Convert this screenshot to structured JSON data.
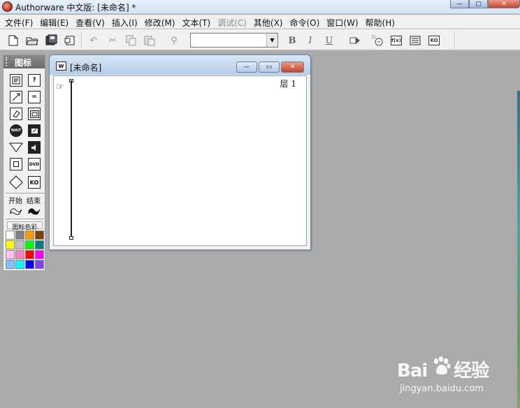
{
  "app": {
    "title": "Authorware 中文版: [未命名] *",
    "window_buttons": {
      "minimize": "—",
      "maximize": "□",
      "close": "✕"
    }
  },
  "menubar": {
    "items": [
      {
        "label": "文件(F)",
        "enabled": true
      },
      {
        "label": "编辑(E)",
        "enabled": true
      },
      {
        "label": "查看(V)",
        "enabled": true
      },
      {
        "label": "插入(I)",
        "enabled": true
      },
      {
        "label": "修改(M)",
        "enabled": true
      },
      {
        "label": "文本(T)",
        "enabled": true
      },
      {
        "label": "调试(C)",
        "enabled": false
      },
      {
        "label": "其他(X)",
        "enabled": true
      },
      {
        "label": "命令(O)",
        "enabled": true
      },
      {
        "label": "窗口(W)",
        "enabled": true
      },
      {
        "label": "帮助(H)",
        "enabled": true
      }
    ]
  },
  "toolbar": {
    "new_icon": "new-file-icon",
    "open_icon": "open-folder-icon",
    "save_all_icon": "save-all-icon",
    "import_icon": "import-icon",
    "undo_icon": "undo-icon",
    "cut_icon": "cut-icon",
    "copy_icon": "copy-icon",
    "paste_icon": "paste-icon",
    "find_icon": "find-icon",
    "font_select_value": "",
    "bold_label": "B",
    "italic_label": "I",
    "underline_label": "U",
    "run_icon": "run-icon",
    "control_panel_icon": "control-panel-icon",
    "functions_label": "f(x)",
    "variables_icon": "variables-icon",
    "knowledge_objects_label": "KO"
  },
  "palette": {
    "title": "图标",
    "icons": [
      {
        "name": "display-icon"
      },
      {
        "name": "motion-icon"
      },
      {
        "name": "erase-icon"
      },
      {
        "name": "wait-icon"
      },
      {
        "name": "navigate-icon"
      },
      {
        "name": "framework-icon"
      },
      {
        "name": "decision-icon"
      },
      {
        "name": "interaction-icon"
      },
      {
        "name": "calculation-icon"
      },
      {
        "name": "map-icon"
      },
      {
        "name": "digital-movie-icon"
      },
      {
        "name": "sound-icon"
      },
      {
        "name": "video-icon"
      },
      {
        "name": "knowledge-object-icon"
      }
    ],
    "icon_text": {
      "wait": "WAIT",
      "dvd": "DVD",
      "ko": "KO",
      "calc": "="
    },
    "start_label": "开始",
    "end_label": "结束",
    "color_label": "图标色彩",
    "colors": [
      "#ffffff",
      "#808080",
      "#ff9900",
      "#804000",
      "#ffff00",
      "#c0c0c0",
      "#00ff00",
      "#008080",
      "#ffc0ff",
      "#ff80c0",
      "#ff0000",
      "#ff00ff",
      "#80c0ff",
      "#00ffff",
      "#0000ff",
      "#8040ff"
    ]
  },
  "design_window": {
    "title": "[未命名]",
    "icon_label": "W",
    "layer_label": "层 1",
    "buttons": {
      "minimize": "—",
      "restore": "▭",
      "close": "✕"
    }
  },
  "watermark": {
    "logo_text_1": "Bai",
    "logo_text_2": "经验",
    "url": "jingyan.baidu.com"
  }
}
